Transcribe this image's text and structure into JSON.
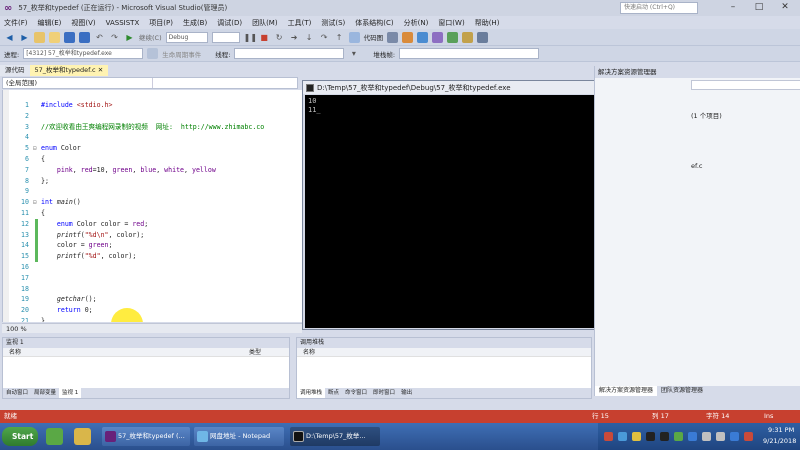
{
  "window": {
    "title": "57_枚举和typedef (正在运行) - Microsoft Visual Studio(管理员)",
    "quick_launch": "快速启动 (Ctrl+Q)"
  },
  "menu": [
    "文件(F)",
    "编辑(E)",
    "视图(V)",
    "VASSISTX",
    "项目(P)",
    "生成(B)",
    "调试(D)",
    "团队(M)",
    "工具(T)",
    "测试(S)",
    "体系结构(C)",
    "分析(N)",
    "窗口(W)",
    "帮助(H)"
  ],
  "toolbar": {
    "config": "Debug",
    "process_label": "进程:",
    "process_value": "[4312] 57_枚举和typedef.exe",
    "lifecycle_label": "生命周期事件",
    "thread_label": "线程:",
    "stack_label": "堆栈帧:",
    "code_map": "代码图"
  },
  "editor": {
    "left_tab": "源代码",
    "file_tab": "57_枚举和typedef.c",
    "scope": "(全局范围)",
    "zoom": "100 %",
    "lines": [
      {
        "n": "1",
        "fold": "",
        "html": "<span class='kw'>#include</span> <span class='st'>&lt;stdio.h&gt;</span>"
      },
      {
        "n": "2",
        "fold": "",
        "html": ""
      },
      {
        "n": "3",
        "fold": "",
        "html": "<span class='cm'>//欢迎收看由王爽编程网录制的视频  网址:  http://www.zhimabc.co</span>"
      },
      {
        "n": "4",
        "fold": "",
        "html": ""
      },
      {
        "n": "5",
        "fold": "⊟",
        "html": "<span class='kw'>enum</span> Color"
      },
      {
        "n": "6",
        "fold": "",
        "html": "{"
      },
      {
        "n": "7",
        "fold": "",
        "html": "    <span class='lit'>pink</span>, <span class='lit'>red</span>=10, <span class='lit'>green</span>, <span class='lit'>blue</span>, <span class='lit'>white</span>, <span class='lit'>yellow</span>"
      },
      {
        "n": "8",
        "fold": "",
        "html": "};"
      },
      {
        "n": "9",
        "fold": "",
        "html": ""
      },
      {
        "n": "10",
        "fold": "⊟",
        "html": "<span class='kw'>int</span> <span class='fn'>main</span>()"
      },
      {
        "n": "11",
        "fold": "",
        "html": "{"
      },
      {
        "n": "12",
        "fold": "",
        "html": "    <span class='kw'>enum</span> Color color = <span class='lit'>red</span>;"
      },
      {
        "n": "13",
        "fold": "",
        "html": "    <span class='fn'>printf</span>(<span class='st'>\"%d\\n\"</span>, color);"
      },
      {
        "n": "14",
        "fold": "",
        "html": "    color = <span class='lit'>green</span>;"
      },
      {
        "n": "15",
        "fold": "",
        "html": "    <span class='fn'>printf</span>(<span class='st'>\"%d\"</span>, color);"
      },
      {
        "n": "16",
        "fold": "",
        "html": ""
      },
      {
        "n": "17",
        "fold": "",
        "html": ""
      },
      {
        "n": "18",
        "fold": "",
        "html": ""
      },
      {
        "n": "19",
        "fold": "",
        "html": "    <span class='fn'>getchar</span>();"
      },
      {
        "n": "20",
        "fold": "",
        "html": "    <span class='kw'>return</span> 0;"
      },
      {
        "n": "21",
        "fold": "",
        "html": "}"
      }
    ]
  },
  "console": {
    "title": "D:\\Temp\\57_枚举和typedef\\Debug\\57_枚举和typedef.exe",
    "output": [
      "10",
      "11_"
    ]
  },
  "solution_explorer": {
    "title": "解决方案资源管理器",
    "count_text": "(1 个项目)",
    "file_text": "ef.c",
    "bottom_tabs": [
      "解决方案资源管理器",
      "团队资源管理器"
    ]
  },
  "locals_panel": {
    "title": "监视 1",
    "col_name": "名称",
    "col_type": "类型",
    "tabs": [
      "自动窗口",
      "局部变量",
      "监视 1"
    ]
  },
  "callstack_panel": {
    "title": "调用堆栈",
    "col_name": "名称",
    "tabs": [
      "调用堆栈",
      "断点",
      "命令窗口",
      "即时窗口",
      "输出"
    ]
  },
  "statusbar": {
    "ready": "就绪",
    "row": "行 15",
    "col": "列 17",
    "char": "字符 14",
    "ins": "Ins"
  },
  "taskbar": {
    "start": "Start",
    "tasks": [
      "57_枚举和typedef (...",
      "网盘地址 - Notepad",
      "D:\\Temp\\57_枚举..."
    ],
    "time": "9:31 PM",
    "date": "9/21/2018"
  },
  "colors": {
    "accent": "#68217a",
    "statusbar": "#c7402f"
  }
}
